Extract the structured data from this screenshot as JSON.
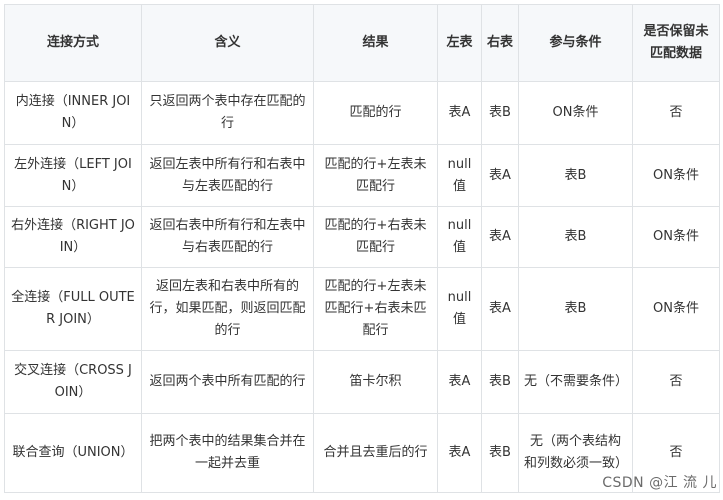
{
  "table": {
    "headers": [
      "连接方式",
      "含义",
      "结果",
      "左表",
      "右表",
      "参与条件",
      "是否保留未匹配数据"
    ],
    "rows": [
      [
        "内连接（INNER JOIN）",
        "只返回两个表中存在匹配的行",
        "匹配的行",
        "表A",
        "表B",
        "ON条件",
        "否"
      ],
      [
        "左外连接（LEFT JOIN）",
        "返回左表中所有行和右表中与左表匹配的行",
        "匹配的行+左表未匹配行",
        "null值",
        "表A",
        "表B",
        "ON条件"
      ],
      [
        "右外连接（RIGHT JOIN）",
        "返回右表中所有行和左表中与右表匹配的行",
        "匹配的行+右表未匹配行",
        "null值",
        "表A",
        "表B",
        "ON条件"
      ],
      [
        "全连接（FULL OUTER JOIN）",
        "返回左表和右表中所有的行，如果匹配，则返回匹配的行",
        "匹配的行+左表未匹配行+右表未匹配行",
        "null值",
        "表A",
        "表B",
        "ON条件"
      ],
      [
        "交叉连接（CROSS JOIN）",
        "返回两个表中所有匹配的行",
        "笛卡尔积",
        "表A",
        "表B",
        "无（不需要条件）",
        "否"
      ],
      [
        "联合查询（UNION）",
        "把两个表中的结果集合并在一起并去重",
        "合并且去重后的行",
        "表A",
        "表B",
        "无（两个表结构和列数必须一致）",
        "否"
      ]
    ]
  },
  "watermark": "CSDN @江 流 儿"
}
